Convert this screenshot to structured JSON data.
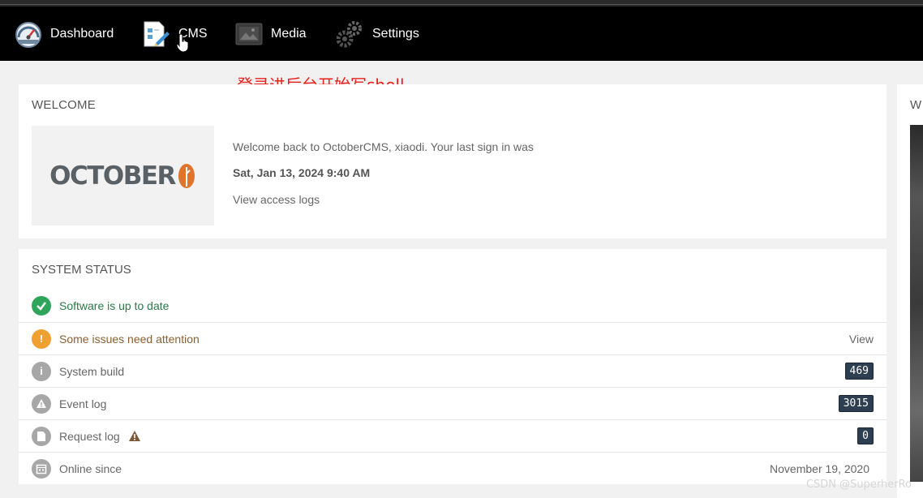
{
  "nav": {
    "dashboard": "Dashboard",
    "cms": "CMS",
    "media": "Media",
    "settings": "Settings"
  },
  "annotation": "登录进后台开始写shell",
  "welcome": {
    "title": "WELCOME",
    "logo_text": "OCTOBER",
    "message": "Welcome back to OctoberCMS, xiaodi. Your last sign in was",
    "last_signin": "Sat, Jan 13, 2024 9:40 AM",
    "access_logs_link": "View access logs"
  },
  "system_status": {
    "title": "SYSTEM STATUS",
    "rows": [
      {
        "label": "Software is up to date",
        "icon": "check-icon"
      },
      {
        "label": "Some issues need attention",
        "icon": "exclamation-icon",
        "action": "View"
      },
      {
        "label": "System build",
        "icon": "info-icon",
        "badge": "469"
      },
      {
        "label": "Event log",
        "icon": "warning-icon",
        "badge": "3015"
      },
      {
        "label": "Request log",
        "icon": "document-icon",
        "badge": "0"
      },
      {
        "label": "Online since",
        "icon": "calendar-icon",
        "value": "November 19, 2020"
      }
    ]
  },
  "side_panel": {
    "title_initial": "W"
  },
  "watermark": "CSDN @SuperherRo",
  "colors": {
    "navbar": "#000000",
    "success": "#2ea55b",
    "warning": "#f0a030",
    "neutral_icon": "#a7a7a7",
    "badge": "#2c3e50",
    "annotation": "#e8211c",
    "logo_leaf": "#e1742b"
  }
}
